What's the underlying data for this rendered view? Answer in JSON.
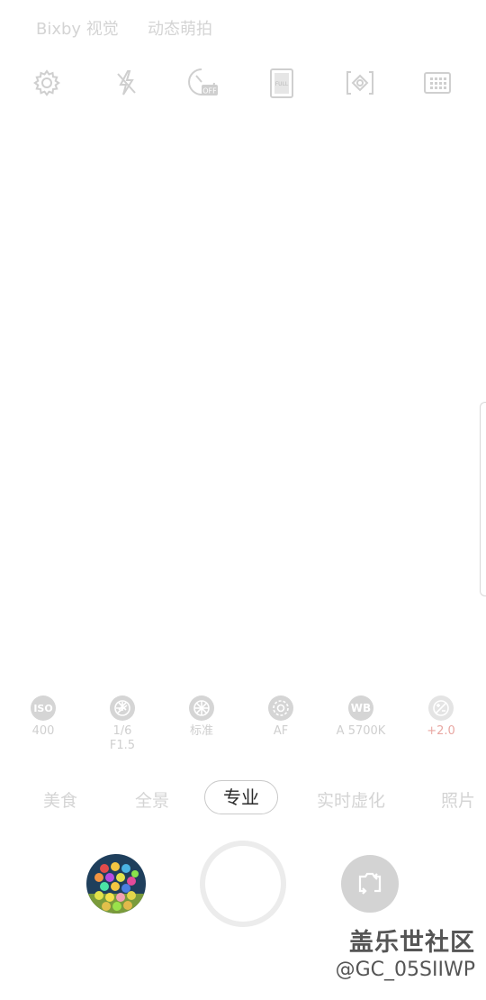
{
  "top_modes": [
    "Bixby 视觉",
    "动态萌拍"
  ],
  "toolbar": {
    "icons": [
      "gear-icon",
      "flash-off-icon",
      "timer-off-icon",
      "full-aspect-icon",
      "focus-metering-icon",
      "grid-icon"
    ],
    "timer_badge": "OFF",
    "aspect_badge": "FULL"
  },
  "pro_controls": [
    {
      "icon": "iso-icon",
      "label": "ISO",
      "value": "400"
    },
    {
      "icon": "aperture-icon",
      "label": "",
      "value": "1/6",
      "value2": "F1.5"
    },
    {
      "icon": "color-tone-icon",
      "label": "",
      "value": "标准"
    },
    {
      "icon": "focus-icon",
      "label": "",
      "value": "AF"
    },
    {
      "icon": "white-balance-icon",
      "label": "WB",
      "value": "A 5700K"
    },
    {
      "icon": "exposure-icon",
      "label": "",
      "value": "+2.0"
    }
  ],
  "modes": [
    "美食",
    "全景",
    "专业",
    "实时虚化",
    "照片"
  ],
  "active_mode": "专业",
  "watermark": {
    "line1": "盖乐世社区",
    "line2": "@GC_05SIIWP"
  },
  "colors": {
    "accent": "#e8a7a2",
    "inactive": "#d4d4d4",
    "active_text": "#2a2a2a"
  }
}
